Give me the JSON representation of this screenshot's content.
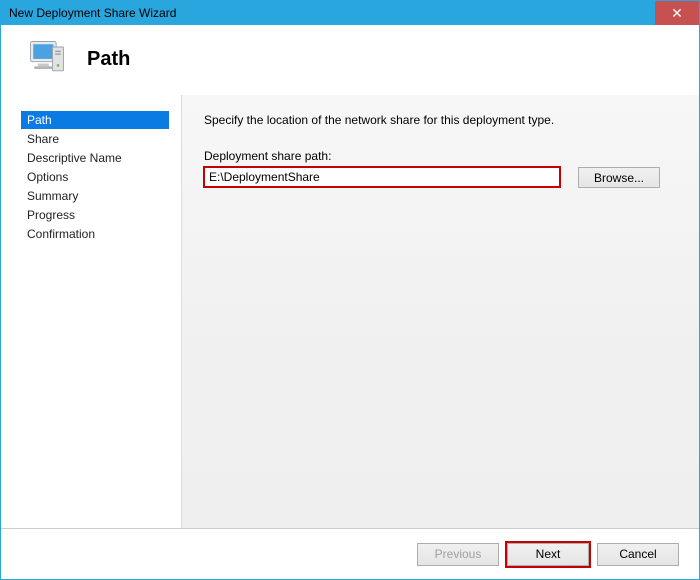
{
  "window": {
    "title": "New Deployment Share Wizard",
    "close_label": "✕"
  },
  "header": {
    "page_title": "Path"
  },
  "sidebar": {
    "items": [
      {
        "label": "Path",
        "selected": true
      },
      {
        "label": "Share",
        "selected": false
      },
      {
        "label": "Descriptive Name",
        "selected": false
      },
      {
        "label": "Options",
        "selected": false
      },
      {
        "label": "Summary",
        "selected": false
      },
      {
        "label": "Progress",
        "selected": false
      },
      {
        "label": "Confirmation",
        "selected": false
      }
    ]
  },
  "main": {
    "instruction": "Specify the location of the network share for this deployment type.",
    "path_label": "Deployment share path:",
    "path_value": "E:\\DeploymentShare",
    "browse_label": "Browse..."
  },
  "footer": {
    "previous": "Previous",
    "next": "Next",
    "cancel": "Cancel"
  }
}
